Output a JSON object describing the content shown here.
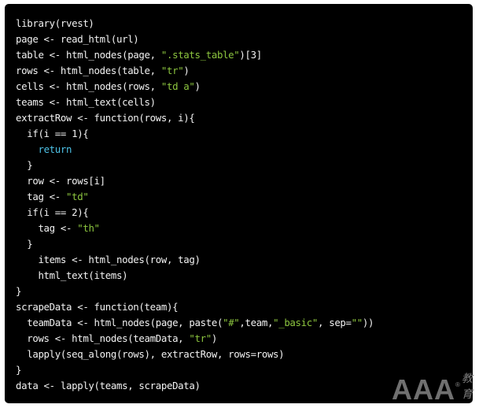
{
  "code": {
    "language": "r",
    "lines": [
      [
        {
          "t": "library(rvest)"
        }
      ],
      [
        {
          "t": "page <- read_html(url)"
        }
      ],
      [
        {
          "t": "table <- html_nodes(page, "
        },
        {
          "t": "\".stats_table\"",
          "c": "str"
        },
        {
          "t": ")[3]"
        }
      ],
      [
        {
          "t": "rows <- html_nodes(table, "
        },
        {
          "t": "\"tr\"",
          "c": "str"
        },
        {
          "t": ")"
        }
      ],
      [
        {
          "t": "cells <- html_nodes(rows, "
        },
        {
          "t": "\"td a\"",
          "c": "str"
        },
        {
          "t": ")"
        }
      ],
      [
        {
          "t": "teams <- html_text(cells)"
        }
      ],
      [
        {
          "t": "extractRow <- function(rows, i){"
        }
      ],
      [
        {
          "t": "  if(i == 1){"
        }
      ],
      [
        {
          "t": "    "
        },
        {
          "t": "return",
          "c": "kw"
        }
      ],
      [
        {
          "t": "  }"
        }
      ],
      [
        {
          "t": "  row <- rows[i]"
        }
      ],
      [
        {
          "t": "  tag <- "
        },
        {
          "t": "\"td\"",
          "c": "str"
        }
      ],
      [
        {
          "t": "  if(i == 2){"
        }
      ],
      [
        {
          "t": "    tag <- "
        },
        {
          "t": "\"th\"",
          "c": "str"
        }
      ],
      [
        {
          "t": "  }"
        }
      ],
      [
        {
          "t": "    items <- html_nodes(row, tag)"
        }
      ],
      [
        {
          "t": "    html_text(items)"
        }
      ],
      [
        {
          "t": "}"
        }
      ],
      [
        {
          "t": "scrapeData <- function(team){"
        }
      ],
      [
        {
          "t": "  teamData <- html_nodes(page, paste("
        },
        {
          "t": "\"#\"",
          "c": "str"
        },
        {
          "t": ",team,"
        },
        {
          "t": "\"_basic\"",
          "c": "str"
        },
        {
          "t": ", sep="
        },
        {
          "t": "\"\"",
          "c": "str"
        },
        {
          "t": "))"
        }
      ],
      [
        {
          "t": "  rows <- html_nodes(teamData, "
        },
        {
          "t": "\"tr\"",
          "c": "str"
        },
        {
          "t": ")"
        }
      ],
      [
        {
          "t": "  lapply(seq_along(rows), extractRow, rows=rows)"
        }
      ],
      [
        {
          "t": "}"
        }
      ],
      [
        {
          "t": "data <- lapply(teams, scrapeData)"
        }
      ]
    ]
  },
  "watermark": {
    "logo": "AAA",
    "registered": "®",
    "text": "教育"
  },
  "colors": {
    "background": "#000000",
    "text": "#f2f2f2",
    "string": "#8dc63f",
    "keyword": "#4ec3e8"
  }
}
